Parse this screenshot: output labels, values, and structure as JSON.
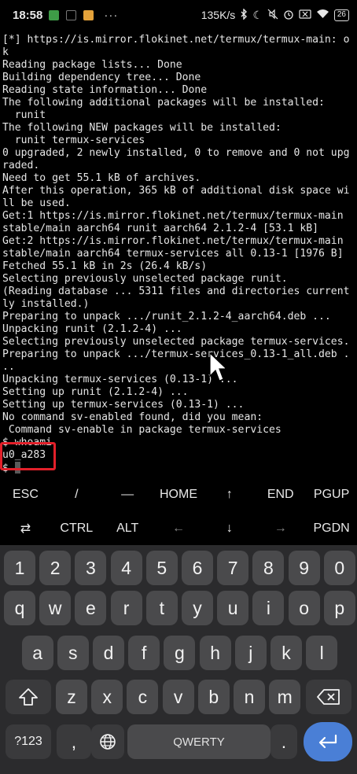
{
  "status_bar": {
    "time": "18:58",
    "speed": "135K/s",
    "battery": "26",
    "dots": "···"
  },
  "terminal": {
    "lines": [
      "[*] https://is.mirror.flokinet.net/termux/termux-main: o",
      "k",
      "Reading package lists... Done",
      "Building dependency tree... Done",
      "Reading state information... Done",
      "The following additional packages will be installed:",
      "  runit",
      "The following NEW packages will be installed:",
      "  runit termux-services",
      "0 upgraded, 2 newly installed, 0 to remove and 0 not upg",
      "raded.",
      "Need to get 55.1 kB of archives.",
      "After this operation, 365 kB of additional disk space wi",
      "ll be used.",
      "Get:1 https://is.mirror.flokinet.net/termux/termux-main",
      "stable/main aarch64 runit aarch64 2.1.2-4 [53.1 kB]",
      "Get:2 https://is.mirror.flokinet.net/termux/termux-main",
      "stable/main aarch64 termux-services all 0.13-1 [1976 B]",
      "Fetched 55.1 kB in 2s (26.4 kB/s)",
      "Selecting previously unselected package runit.",
      "(Reading database ... 5311 files and directories current",
      "ly installed.)",
      "Preparing to unpack .../runit_2.1.2-4_aarch64.deb ...",
      "Unpacking runit (2.1.2-4) ...",
      "Selecting previously unselected package termux-services.",
      "Preparing to unpack .../termux-services_0.13-1_all.deb .",
      "..",
      "Unpacking termux-services (0.13-1) ...",
      "Setting up runit (2.1.2-4) ...",
      "Setting up termux-services (0.13-1) ...",
      "No command sv-enabled found, did you mean:",
      " Command sv-enable in package termux-services",
      "$ whoami",
      "u0_a283"
    ],
    "prompt": "$ "
  },
  "extra_keys": {
    "row1": [
      "ESC",
      "/",
      "—",
      "HOME",
      "↑",
      "END",
      "PGUP"
    ],
    "row2": [
      "⇄",
      "CTRL",
      "ALT",
      "←",
      "↓",
      "→",
      "PGDN"
    ]
  },
  "keyboard": {
    "numbers": [
      "1",
      "2",
      "3",
      "4",
      "5",
      "6",
      "7",
      "8",
      "9",
      "0"
    ],
    "row_q": [
      "q",
      "w",
      "e",
      "r",
      "t",
      "y",
      "u",
      "i",
      "o",
      "p"
    ],
    "row_a": [
      "a",
      "s",
      "d",
      "f",
      "g",
      "h",
      "j",
      "k",
      "l"
    ],
    "row_z": [
      "z",
      "x",
      "c",
      "v",
      "b",
      "n",
      "m"
    ],
    "symbols_label": "?123",
    "comma": ",",
    "space_label": "QWERTY",
    "period": ".",
    "shift_icon": "shift-icon",
    "backspace_icon": "backspace-icon",
    "globe_icon": "globe-icon",
    "enter_icon": "enter-icon"
  },
  "colors": {
    "highlight_box": "#e2202a",
    "enter_key": "#4a7fd6",
    "keyboard_bg": "#2b2b2d",
    "key_bg": "#4a4a4c"
  }
}
